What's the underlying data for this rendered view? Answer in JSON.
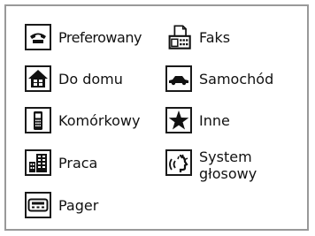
{
  "items": [
    {
      "key": "phone",
      "label": "Preferowany",
      "icon": "telephone-icon"
    },
    {
      "key": "fax",
      "label": "Faks",
      "icon": "fax-icon"
    },
    {
      "key": "home",
      "label": "Do domu",
      "icon": "house-icon"
    },
    {
      "key": "car",
      "label": "Samochód",
      "icon": "car-icon"
    },
    {
      "key": "mobile",
      "label": "Komórkowy",
      "icon": "mobile-phone-icon"
    },
    {
      "key": "other",
      "label": "Inne",
      "icon": "star-icon"
    },
    {
      "key": "work",
      "label": "Praca",
      "icon": "office-building-icon"
    },
    {
      "key": "voice",
      "label": "System głosowy",
      "icon": "voice-speaking-icon"
    },
    {
      "key": "pager",
      "label": "Pager",
      "icon": "pager-icon"
    }
  ]
}
